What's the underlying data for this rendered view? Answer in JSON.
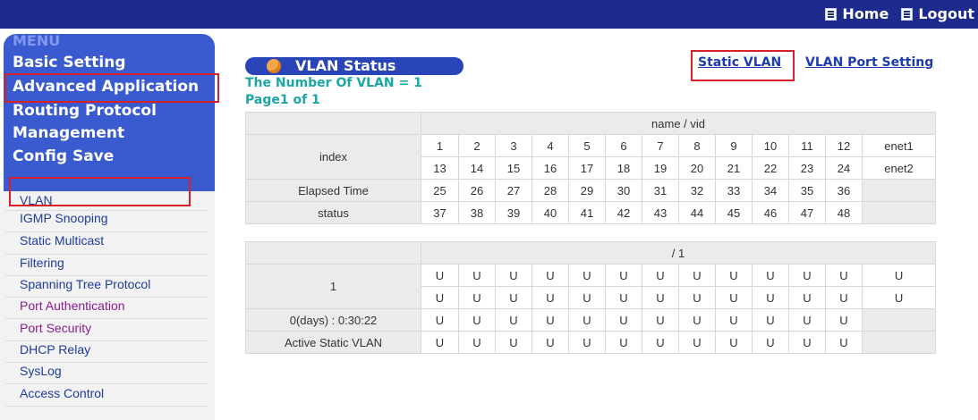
{
  "header": {
    "links": [
      {
        "label": "Home",
        "icon": "home-icon"
      },
      {
        "label": "Logout",
        "icon": "logout-icon"
      }
    ]
  },
  "menu": {
    "title": "MENU",
    "items": [
      "Basic Setting",
      "Advanced Application",
      "Routing Protocol",
      "Management",
      "Config Save"
    ],
    "highlighted": "Advanced Application"
  },
  "left_nav": {
    "items": [
      "VLAN",
      "IGMP Snooping",
      "Static Multicast",
      "Filtering",
      "Spanning Tree Protocol",
      "Port Authentication",
      "Port Security",
      "DHCP Relay",
      "SysLog",
      "Access Control"
    ],
    "highlighted": "VLAN"
  },
  "main": {
    "section_title": "VLAN Status",
    "vlan_count": "The Number Of VLAN =  1",
    "page": "Page1  of  1",
    "links": [
      "Static VLAN",
      "VLAN Port Setting"
    ]
  },
  "table1": {
    "header": "name  /  vid",
    "rows": [
      {
        "label": "index",
        "cells": [
          "1",
          "2",
          "3",
          "4",
          "5",
          "6",
          "7",
          "8",
          "9",
          "10",
          "11",
          "12",
          "enet1"
        ]
      },
      {
        "label": "",
        "cells": [
          "13",
          "14",
          "15",
          "16",
          "17",
          "18",
          "19",
          "20",
          "21",
          "22",
          "23",
          "24",
          "enet2"
        ]
      },
      {
        "label": "Elapsed Time",
        "cells": [
          "25",
          "26",
          "27",
          "28",
          "29",
          "30",
          "31",
          "32",
          "33",
          "34",
          "35",
          "36",
          ""
        ]
      },
      {
        "label": "status",
        "cells": [
          "37",
          "38",
          "39",
          "40",
          "41",
          "42",
          "43",
          "44",
          "45",
          "46",
          "47",
          "48",
          ""
        ]
      }
    ]
  },
  "table2": {
    "header": "/ 1",
    "rows": [
      {
        "label": "1",
        "cells": [
          "U",
          "U",
          "U",
          "U",
          "U",
          "U",
          "U",
          "U",
          "U",
          "U",
          "U",
          "U",
          "U"
        ]
      },
      {
        "label": "",
        "cells": [
          "U",
          "U",
          "U",
          "U",
          "U",
          "U",
          "U",
          "U",
          "U",
          "U",
          "U",
          "U",
          "U"
        ]
      },
      {
        "label": "0(days) : 0:30:22",
        "cells": [
          "U",
          "U",
          "U",
          "U",
          "U",
          "U",
          "U",
          "U",
          "U",
          "U",
          "U",
          "U",
          ""
        ]
      },
      {
        "label": "Active Static VLAN",
        "cells": [
          "U",
          "U",
          "U",
          "U",
          "U",
          "U",
          "U",
          "U",
          "U",
          "U",
          "U",
          "U",
          ""
        ]
      }
    ]
  },
  "colors": {
    "topbar": "#1c2b8c",
    "menu": "#3a5bcf",
    "highlight_box": "#d6202a",
    "link": "#1d3cb0",
    "teal_text": "#1ca6a6",
    "nav_purple": "#8a1e8e"
  }
}
